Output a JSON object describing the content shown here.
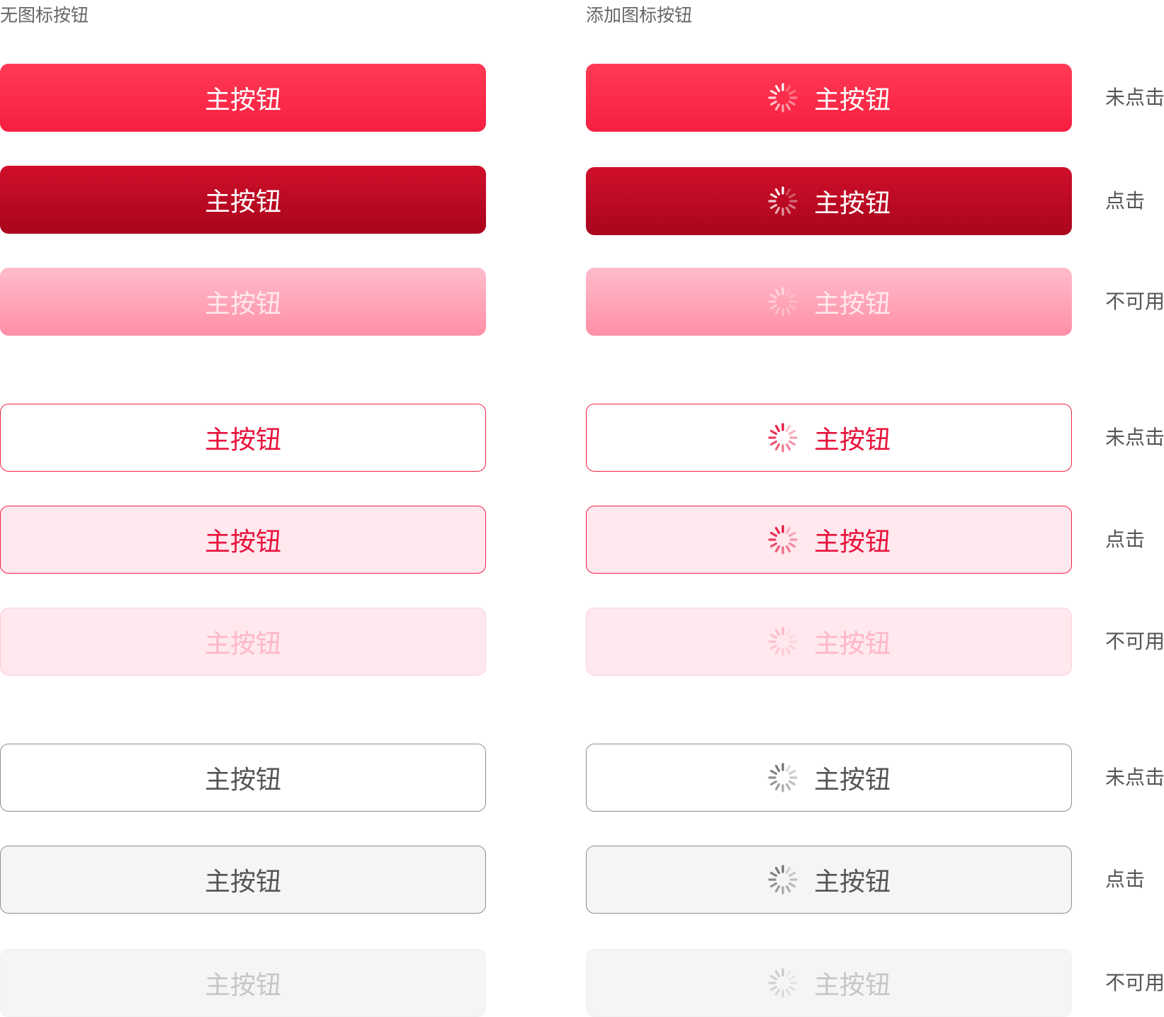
{
  "headings": {
    "no_icon": "无图标按钮",
    "with_icon": "添加图标按钮"
  },
  "button_label": "主按钮",
  "state_labels": {
    "normal": "未点击",
    "pressed": "点击",
    "disabled": "不可用"
  },
  "icon": "loading-spinner-icon",
  "colors": {
    "primary": "#f71f40",
    "primary_pressed": "#a9051d",
    "primary_disabled": "#ff8fa6",
    "outline_border": "#ee2246",
    "outline_pressed_fill": "#ffe8ee",
    "gray_text": "#555555",
    "gray_border": "#8e8e8e",
    "gray_pressed_fill": "#f4f5f5"
  },
  "groups": [
    {
      "variant": "solid",
      "rows": [
        {
          "state": "normal"
        },
        {
          "state": "pressed"
        },
        {
          "state": "disabled"
        }
      ]
    },
    {
      "variant": "outline",
      "rows": [
        {
          "state": "normal"
        },
        {
          "state": "pressed"
        },
        {
          "state": "disabled"
        }
      ]
    },
    {
      "variant": "gray",
      "rows": [
        {
          "state": "normal"
        },
        {
          "state": "pressed"
        },
        {
          "state": "disabled"
        }
      ]
    }
  ]
}
